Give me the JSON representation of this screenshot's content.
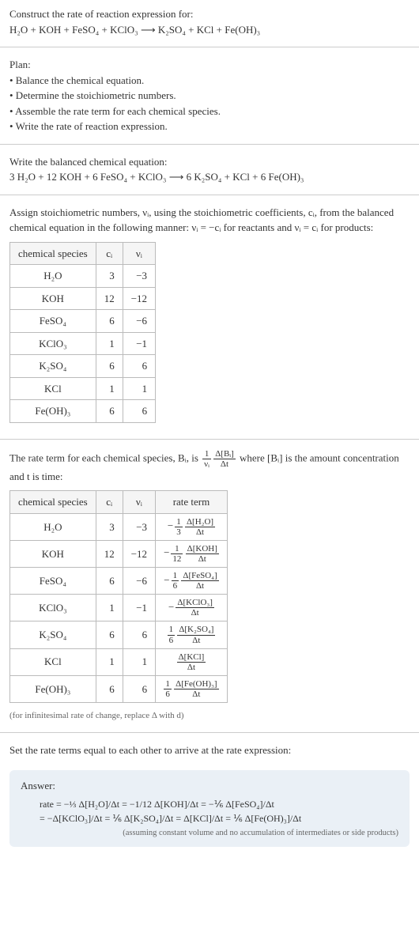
{
  "intro": {
    "title": "Construct the rate of reaction expression for:",
    "equation": "H₂O + KOH + FeSO₄ + KClO₃  ⟶  K₂SO₄ + KCl + Fe(OH)₃"
  },
  "plan": {
    "heading": "Plan:",
    "items": [
      "• Balance the chemical equation.",
      "• Determine the stoichiometric numbers.",
      "• Assemble the rate term for each chemical species.",
      "• Write the rate of reaction expression."
    ]
  },
  "balanced": {
    "heading": "Write the balanced chemical equation:",
    "equation": "3 H₂O + 12 KOH + 6 FeSO₄ + KClO₃  ⟶  6 K₂SO₄ + KCl + 6 Fe(OH)₃"
  },
  "stoich": {
    "text": "Assign stoichiometric numbers, νᵢ, using the stoichiometric coefficients, cᵢ, from the balanced chemical equation in the following manner: νᵢ = −cᵢ for reactants and νᵢ = cᵢ for products:",
    "headers": [
      "chemical species",
      "cᵢ",
      "νᵢ"
    ],
    "rows": [
      {
        "species": "H₂O",
        "c": "3",
        "v": "−3"
      },
      {
        "species": "KOH",
        "c": "12",
        "v": "−12"
      },
      {
        "species": "FeSO₄",
        "c": "6",
        "v": "−6"
      },
      {
        "species": "KClO₃",
        "c": "1",
        "v": "−1"
      },
      {
        "species": "K₂SO₄",
        "c": "6",
        "v": "6"
      },
      {
        "species": "KCl",
        "c": "1",
        "v": "1"
      },
      {
        "species": "Fe(OH)₃",
        "c": "6",
        "v": "6"
      }
    ]
  },
  "rateterm": {
    "text_a": "The rate term for each chemical species, Bᵢ, is ",
    "text_b": " where [Bᵢ] is the amount concentration and t is time:",
    "headers": [
      "chemical species",
      "cᵢ",
      "νᵢ",
      "rate term"
    ],
    "rows": [
      {
        "species": "H₂O",
        "c": "3",
        "v": "−3",
        "term": "−⅓ Δ[H₂O]/Δt"
      },
      {
        "species": "KOH",
        "c": "12",
        "v": "−12",
        "term": "−1/12 Δ[KOH]/Δt"
      },
      {
        "species": "FeSO₄",
        "c": "6",
        "v": "−6",
        "term": "−⅙ Δ[FeSO₄]/Δt"
      },
      {
        "species": "KClO₃",
        "c": "1",
        "v": "−1",
        "term": "−Δ[KClO₃]/Δt"
      },
      {
        "species": "K₂SO₄",
        "c": "6",
        "v": "6",
        "term": "⅙ Δ[K₂SO₄]/Δt"
      },
      {
        "species": "KCl",
        "c": "1",
        "v": "1",
        "term": "Δ[KCl]/Δt"
      },
      {
        "species": "Fe(OH)₃",
        "c": "6",
        "v": "6",
        "term": "⅙ Δ[Fe(OH)₃]/Δt"
      }
    ],
    "note": "(for infinitesimal rate of change, replace Δ with d)"
  },
  "final": {
    "text": "Set the rate terms equal to each other to arrive at the rate expression:"
  },
  "answer": {
    "title": "Answer:",
    "line1": "rate = −⅓ Δ[H₂O]/Δt = −1/12 Δ[KOH]/Δt = −⅙ Δ[FeSO₄]/Δt",
    "line2": "= −Δ[KClO₃]/Δt = ⅙ Δ[K₂SO₄]/Δt = Δ[KCl]/Δt = ⅙ Δ[Fe(OH)₃]/Δt",
    "note": "(assuming constant volume and no accumulation of intermediates or side products)"
  },
  "chart_data": {
    "type": "table",
    "tables": [
      {
        "title": "stoichiometric numbers",
        "columns": [
          "chemical species",
          "cᵢ",
          "νᵢ"
        ],
        "rows": [
          [
            "H₂O",
            3,
            -3
          ],
          [
            "KOH",
            12,
            -12
          ],
          [
            "FeSO₄",
            6,
            -6
          ],
          [
            "KClO₃",
            1,
            -1
          ],
          [
            "K₂SO₄",
            6,
            6
          ],
          [
            "KCl",
            1,
            1
          ],
          [
            "Fe(OH)₃",
            6,
            6
          ]
        ]
      },
      {
        "title": "rate terms",
        "columns": [
          "chemical species",
          "cᵢ",
          "νᵢ",
          "rate term"
        ],
        "rows": [
          [
            "H₂O",
            3,
            -3,
            "-(1/3) d[H2O]/dt"
          ],
          [
            "KOH",
            12,
            -12,
            "-(1/12) d[KOH]/dt"
          ],
          [
            "FeSO₄",
            6,
            -6,
            "-(1/6) d[FeSO4]/dt"
          ],
          [
            "KClO₃",
            1,
            -1,
            "-d[KClO3]/dt"
          ],
          [
            "K₂SO₄",
            6,
            6,
            "(1/6) d[K2SO4]/dt"
          ],
          [
            "KCl",
            1,
            1,
            "d[KCl]/dt"
          ],
          [
            "Fe(OH)₃",
            6,
            6,
            "(1/6) d[Fe(OH)3]/dt"
          ]
        ]
      }
    ]
  }
}
